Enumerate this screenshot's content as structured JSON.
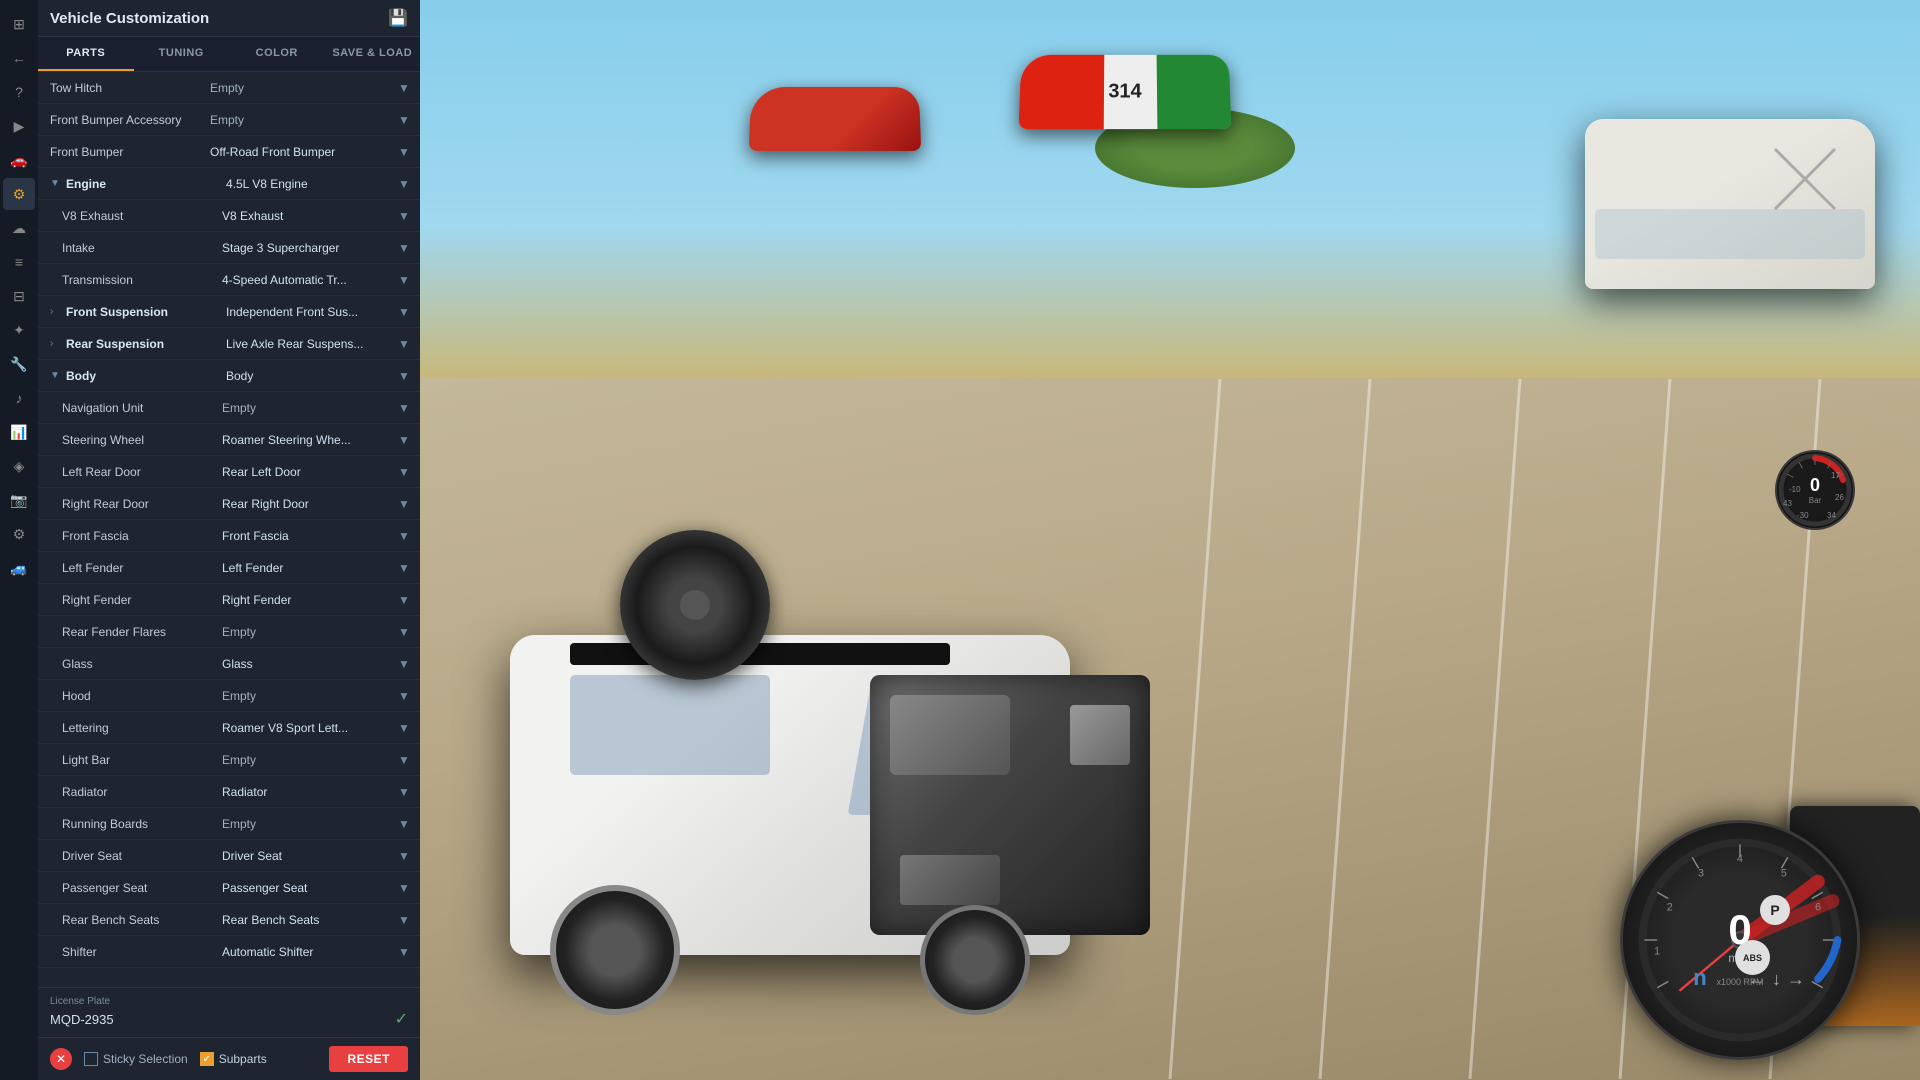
{
  "panel": {
    "title": "Vehicle Customization",
    "save_icon": "💾",
    "tabs": [
      {
        "label": "PARTS",
        "active": true
      },
      {
        "label": "TUNING",
        "active": false
      },
      {
        "label": "COLOR",
        "active": false
      },
      {
        "label": "SAVE & LOAD",
        "active": false
      }
    ]
  },
  "parts": [
    {
      "id": "tow-hitch",
      "name": "Tow Hitch",
      "value": "Empty",
      "indent": 0,
      "expandable": false,
      "has_value": false
    },
    {
      "id": "front-bumper-accessory",
      "name": "Front Bumper Accessory",
      "value": "Empty",
      "indent": 0,
      "expandable": false,
      "has_value": false
    },
    {
      "id": "front-bumper",
      "name": "Front Bumper",
      "value": "Off-Road Front Bumper",
      "indent": 0,
      "expandable": false,
      "has_value": true
    },
    {
      "id": "engine",
      "name": "Engine",
      "value": "4.5L V8 Engine",
      "indent": 0,
      "expandable": true,
      "expanded": true,
      "has_value": true,
      "is_category": true
    },
    {
      "id": "v8-exhaust",
      "name": "V8 Exhaust",
      "value": "V8 Exhaust",
      "indent": 1,
      "expandable": false,
      "has_value": true
    },
    {
      "id": "intake",
      "name": "Intake",
      "value": "Stage 3 Supercharger",
      "indent": 1,
      "expandable": false,
      "has_value": true
    },
    {
      "id": "transmission",
      "name": "Transmission",
      "value": "4-Speed Automatic Tr...",
      "indent": 1,
      "expandable": false,
      "has_value": true
    },
    {
      "id": "front-suspension",
      "name": "Front Suspension",
      "value": "Independent Front Sus...",
      "indent": 0,
      "expandable": true,
      "expanded": false,
      "has_value": true,
      "is_category": true
    },
    {
      "id": "rear-suspension",
      "name": "Rear Suspension",
      "value": "Live Axle Rear Suspens...",
      "indent": 0,
      "expandable": true,
      "expanded": false,
      "has_value": true,
      "is_category": true
    },
    {
      "id": "body",
      "name": "Body",
      "value": "Body",
      "indent": 0,
      "expandable": true,
      "expanded": true,
      "has_value": true,
      "is_category": true
    },
    {
      "id": "navigation-unit",
      "name": "Navigation Unit",
      "value": "Empty",
      "indent": 1,
      "expandable": false,
      "has_value": false
    },
    {
      "id": "steering-wheel",
      "name": "Steering Wheel",
      "value": "Roamer Steering Whe...",
      "indent": 1,
      "expandable": false,
      "has_value": true
    },
    {
      "id": "left-rear-door",
      "name": "Left Rear Door",
      "value": "Rear Left Door",
      "indent": 1,
      "expandable": false,
      "has_value": true
    },
    {
      "id": "right-rear-door",
      "name": "Right Rear Door",
      "value": "Rear Right Door",
      "indent": 1,
      "expandable": false,
      "has_value": true
    },
    {
      "id": "front-fascia",
      "name": "Front Fascia",
      "value": "Front Fascia",
      "indent": 1,
      "expandable": false,
      "has_value": true
    },
    {
      "id": "left-fender",
      "name": "Left Fender",
      "value": "Left Fender",
      "indent": 1,
      "expandable": false,
      "has_value": true
    },
    {
      "id": "right-fender",
      "name": "Right Fender",
      "value": "Right Fender",
      "indent": 1,
      "expandable": false,
      "has_value": true
    },
    {
      "id": "rear-fender-flares",
      "name": "Rear Fender Flares",
      "value": "Empty",
      "indent": 1,
      "expandable": false,
      "has_value": false
    },
    {
      "id": "glass",
      "name": "Glass",
      "value": "Glass",
      "indent": 1,
      "expandable": false,
      "has_value": true
    },
    {
      "id": "hood",
      "name": "Hood",
      "value": "Empty",
      "indent": 1,
      "expandable": false,
      "has_value": false
    },
    {
      "id": "lettering",
      "name": "Lettering",
      "value": "Roamer V8 Sport Lett...",
      "indent": 1,
      "expandable": false,
      "has_value": true
    },
    {
      "id": "light-bar",
      "name": "Light Bar",
      "value": "Empty",
      "indent": 1,
      "expandable": false,
      "has_value": false
    },
    {
      "id": "radiator",
      "name": "Radiator",
      "value": "Radiator",
      "indent": 1,
      "expandable": false,
      "has_value": true
    },
    {
      "id": "running-boards",
      "name": "Running Boards",
      "value": "Empty",
      "indent": 1,
      "expandable": false,
      "has_value": false
    },
    {
      "id": "driver-seat",
      "name": "Driver Seat",
      "value": "Driver Seat",
      "indent": 1,
      "expandable": false,
      "has_value": true
    },
    {
      "id": "passenger-seat",
      "name": "Passenger Seat",
      "value": "Passenger Seat",
      "indent": 1,
      "expandable": false,
      "has_value": true
    },
    {
      "id": "rear-bench-seats",
      "name": "Rear Bench Seats",
      "value": "Rear Bench Seats",
      "indent": 1,
      "expandable": false,
      "has_value": true
    },
    {
      "id": "shifter",
      "name": "Shifter",
      "value": "Automatic Shifter",
      "indent": 1,
      "expandable": false,
      "has_value": true
    }
  ],
  "license_plate": {
    "label": "License Plate",
    "value": "MQD-2935"
  },
  "bottom_bar": {
    "sticky_selection_label": "Sticky Selection",
    "subparts_label": "Subparts",
    "reset_label": "RESET",
    "sticky_checked": false,
    "subparts_checked": true
  },
  "hud": {
    "speed": "0",
    "speed_unit": "mph",
    "boost": "0",
    "boost_unit": "Bar",
    "gear": "n",
    "parking": "P",
    "abs_label": "ABS",
    "rpm_label": "x1000 RPM"
  },
  "sidebar_icons": [
    {
      "name": "home-icon",
      "symbol": "⊞",
      "active": false
    },
    {
      "name": "back-icon",
      "symbol": "←",
      "active": false
    },
    {
      "name": "help-icon",
      "symbol": "?",
      "active": false
    },
    {
      "name": "play-icon",
      "symbol": "▶",
      "active": false
    },
    {
      "name": "car-icon",
      "symbol": "🚗",
      "active": false
    },
    {
      "name": "settings-icon",
      "symbol": "⚙",
      "active": true
    },
    {
      "name": "cloud-icon",
      "symbol": "☁",
      "active": false
    },
    {
      "name": "list-icon",
      "symbol": "≡",
      "active": false
    },
    {
      "name": "sliders-icon",
      "symbol": "⊟",
      "active": false
    },
    {
      "name": "nodes-icon",
      "symbol": "✦",
      "active": false
    },
    {
      "name": "wrench-icon",
      "symbol": "🔧",
      "active": false
    },
    {
      "name": "volume-icon",
      "symbol": "♪",
      "active": false
    },
    {
      "name": "chart-icon",
      "symbol": "📊",
      "active": false
    },
    {
      "name": "map-icon",
      "symbol": "◈",
      "active": false
    },
    {
      "name": "camera-icon",
      "symbol": "📷",
      "active": false
    },
    {
      "name": "cog-icon",
      "symbol": "⚙",
      "active": false
    },
    {
      "name": "vehicle-icon",
      "symbol": "🚙",
      "active": false
    }
  ]
}
